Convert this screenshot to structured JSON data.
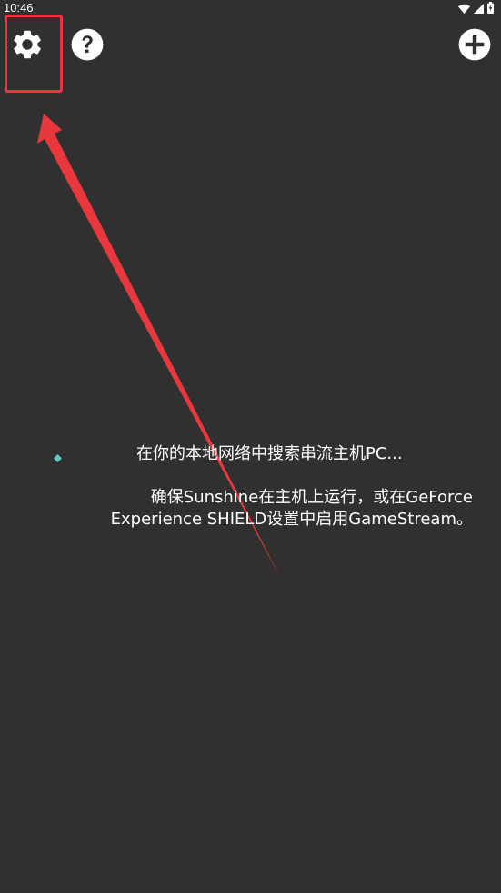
{
  "status_bar": {
    "time": "10:46",
    "icons": [
      "wifi-icon",
      "signal-icon",
      "battery-icon"
    ]
  },
  "toolbar": {
    "settings_icon": "gear-icon",
    "help_icon": "question-icon",
    "add_icon": "plus-icon"
  },
  "annotation": {
    "color": "#e8383d"
  },
  "main": {
    "searching_text": "在你的本地网络中搜索串流主机PC...",
    "hint_line1": "确保Sunshine在主机上运行，或在GeForce",
    "hint_line2": "Experience SHIELD设置中启用GameStream。",
    "spinner_color": "#5fc9c9"
  },
  "theme": {
    "background": "#303030",
    "foreground": "#ffffff"
  }
}
